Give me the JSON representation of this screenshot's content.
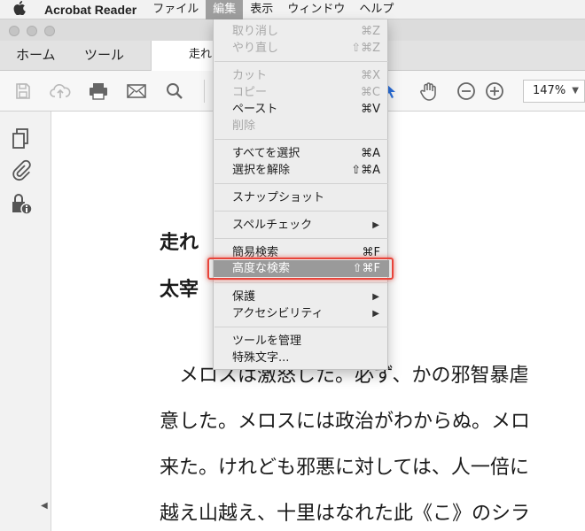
{
  "menubar": {
    "app_name": "Acrobat Reader",
    "items": [
      "ファイル",
      "編集",
      "表示",
      "ウィンドウ",
      "ヘルプ"
    ],
    "active_item": "編集"
  },
  "tabs": {
    "home": "ホーム",
    "tools": "ツール",
    "document": "走れ"
  },
  "toolbar": {
    "zoom": "147%"
  },
  "edit_menu": {
    "undo": {
      "label": "取り消し",
      "shortcut": "⌘Z"
    },
    "redo": {
      "label": "やり直し",
      "shortcut": "⇧⌘Z"
    },
    "cut": {
      "label": "カット",
      "shortcut": "⌘X"
    },
    "copy": {
      "label": "コピー",
      "shortcut": "⌘C"
    },
    "paste": {
      "label": "ペースト",
      "shortcut": "⌘V"
    },
    "delete": {
      "label": "削除"
    },
    "select_all": {
      "label": "すべてを選択",
      "shortcut": "⌘A"
    },
    "deselect": {
      "label": "選択を解除",
      "shortcut": "⇧⌘A"
    },
    "snapshot": {
      "label": "スナップショット"
    },
    "spell_check": {
      "label": "スペルチェック"
    },
    "find": {
      "label": "簡易検索",
      "shortcut": "⌘F"
    },
    "advanced_search": {
      "label": "高度な検索",
      "shortcut": "⇧⌘F"
    },
    "protection": {
      "label": "保護"
    },
    "accessibility": {
      "label": "アクセシビリティ"
    },
    "manage_tools": {
      "label": "ツールを管理"
    },
    "special_chars": {
      "label": "特殊文字..."
    }
  },
  "document": {
    "title_fragment": "走れ",
    "author_fragment": "太宰",
    "lines": [
      "　メロスは激怒した。必ず、かの邪智暴虐",
      "意した。メロスには政治がわからぬ。メロ",
      "来た。けれども邪悪に対しては、人一倍に",
      "越え山越え、十里はなれた此《こ》のシラ"
    ]
  },
  "colors": {
    "highlight_outline": "#e8443a",
    "cursor_blue": "#2a6fdb"
  }
}
